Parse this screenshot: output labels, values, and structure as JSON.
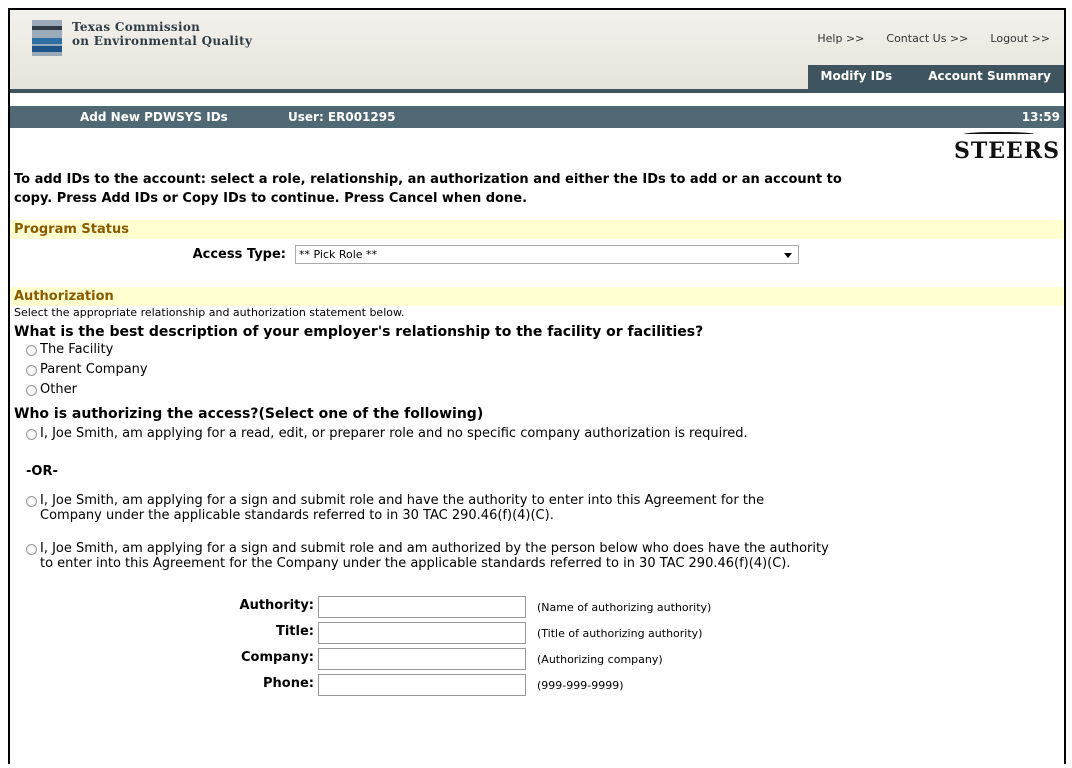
{
  "header": {
    "logo_line1": "Texas Commission",
    "logo_line2": "on Environmental Quality",
    "links": {
      "help": "Help >>",
      "contact": "Contact Us >>",
      "logout": "Logout >>"
    },
    "tabs": {
      "modify": "Modify IDs",
      "summary": "Account Summary"
    }
  },
  "titlebar": {
    "page_title": "Add New PDWSYS IDs",
    "user": "User: ER001295",
    "time": "13:59"
  },
  "brand": "STEERS",
  "intro": "To add IDs to the account: select a role, relationship, an authorization and either the IDs to add or an account to copy. Press Add IDs or Copy IDs to continue. Press Cancel when done.",
  "program_status": {
    "heading": "Program Status",
    "access_label": "Access Type:",
    "access_value": "** Pick Role **"
  },
  "authorization": {
    "heading": "Authorization",
    "instructions": "Select the appropriate relationship and authorization statement below.",
    "relationship_question": "What is the best description of your employer's relationship to the facility or facilities?",
    "relationship_options": [
      "The Facility",
      "Parent Company",
      "Other"
    ],
    "who_question": "Who is authorizing the access?(Select one of the following)",
    "option1": "I, Joe Smith, am applying for a read, edit, or preparer role and no specific company authorization is required.",
    "or_text": "-OR-",
    "option2": "I, Joe Smith, am applying for a sign and submit role and have the authority to enter into this Agreement for the Company under the applicable standards referred to in 30 TAC 290.46(f)(4)(C).",
    "option3": "I, Joe Smith, am applying for a sign and submit role and am authorized by the person below who does have the authority to enter into this Agreement for the Company under the applicable standards referred to in 30 TAC 290.46(f)(4)(C)."
  },
  "authority_form": {
    "authority_label": "Authority:",
    "authority_hint": "(Name of authorizing authority)",
    "title_label": "Title:",
    "title_hint": "(Title of authorizing authority)",
    "company_label": "Company:",
    "company_hint": "(Authorizing company)",
    "phone_label": "Phone:",
    "phone_hint": "(999-999-9999)"
  },
  "colors": {
    "nav_bg": "#3e5560",
    "titlebar_bg": "#506975",
    "section_bg": "#ffffd0",
    "section_text": "#8a5a00"
  }
}
